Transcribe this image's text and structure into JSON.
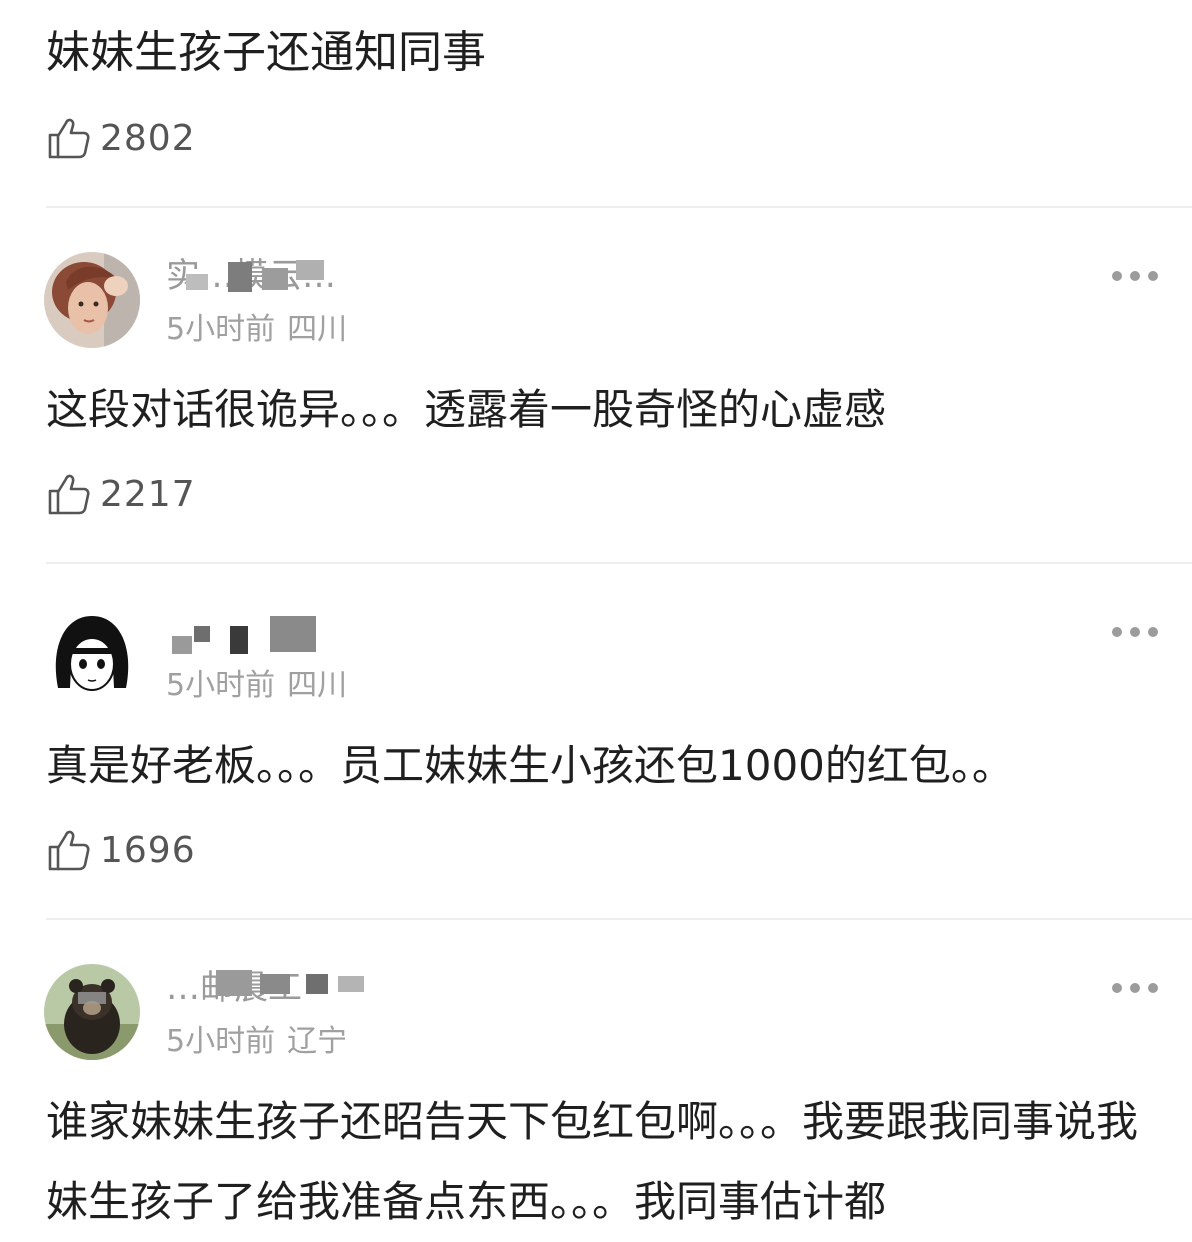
{
  "post": {
    "text": "妹妹生孩子还通知同事",
    "likes": "2802"
  },
  "comments": [
    {
      "username": "实…模云…",
      "time": "5小时前",
      "location": "四川",
      "text": "这段对话很诡异。。。透露着一股奇怪的心虚感",
      "likes": "2217"
    },
    {
      "username": "",
      "time": "5小时前",
      "location": "四川",
      "text": "真是好老板。。。员工妹妹生小孩还包1000的红包。。",
      "likes": "1696"
    },
    {
      "username": "…邮晨工",
      "time": "5小时前",
      "location": "辽宁",
      "text": "谁家妹妹生孩子还昭告天下包红包啊。。。我要跟我同事说我妹生孩子了给我准备点东西。。。我同事估计都",
      "likes": ""
    }
  ],
  "icons": {
    "like": "thumbs-up-icon",
    "more": "more-dots-icon"
  },
  "colors": {
    "text": "#1f1f1f",
    "meta": "#a0a0a0",
    "divider": "#eeeeee"
  }
}
